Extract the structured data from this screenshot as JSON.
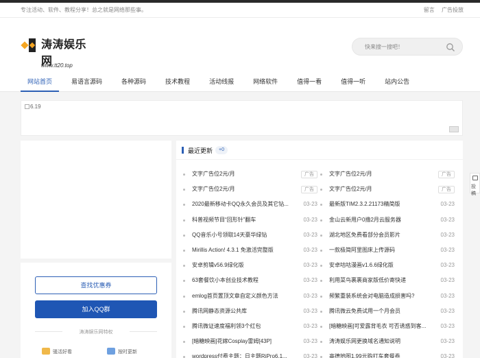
{
  "topbar": {
    "slogan": "专注活动、软件、教程分享！总之就是网络那些事。",
    "links": [
      "留言",
      "广告投放"
    ]
  },
  "logo": {
    "name": "涛涛娱乐网",
    "url": "www.tt20.top"
  },
  "search": {
    "placeholder": "快来搜一搜吧！"
  },
  "nav": {
    "items": [
      "网站首页",
      "易语言源码",
      "各种源码",
      "技术教程",
      "活动线报",
      "网络软件",
      "值得一看",
      "值得一听",
      "站内公告"
    ],
    "active_index": 0
  },
  "banner": {
    "alt": "6.19"
  },
  "left_panel": {
    "coupon_button": "查找优惠券",
    "qq_group_button": "加入QQ群",
    "privilege_title": "涛涛娱乐网特权",
    "features": [
      "骚活好看",
      "按时更新"
    ]
  },
  "latest": {
    "title": "最近更新",
    "count": "+0",
    "col1": [
      {
        "title": "文字广告位2元/月",
        "tag": "广告"
      },
      {
        "title": "文字广告位2元/月",
        "tag": "广告"
      },
      {
        "title": "2020最新移动卡QQ永久会员及其它钻...",
        "date": "03-23"
      },
      {
        "title": "科普视频节目“回形针”翻车",
        "date": "03-23"
      },
      {
        "title": "QQ音乐小号领取14天豪华绿钻",
        "date": "03-23"
      },
      {
        "title": "Mirillis Action! 4.3.1 免激活完整版",
        "date": "03-23"
      },
      {
        "title": "安卓剪辑v56.9绿化版",
        "date": "03-23"
      },
      {
        "title": "63套餐饮小本创业技术教程",
        "date": "03-23"
      },
      {
        "title": "emlog首页置顶文章自定义颜色方法",
        "date": "03-23"
      },
      {
        "title": "腾讯网静态资源公共库",
        "date": "03-23"
      },
      {
        "title": "腾讯微证速度福利领3个红包",
        "date": "03-23"
      },
      {
        "title": "[暗糖映画]花嫁Cosplay雷姆[43P]",
        "date": "03-23"
      },
      {
        "title": "wordpress付费主题：日主题RiPro6.1...",
        "date": "03-23"
      }
    ],
    "col2": [
      {
        "title": "文字广告位2元/月",
        "tag": "广告"
      },
      {
        "title": "文字广告位2元/月",
        "tag": "广告"
      },
      {
        "title": "最新版TIM2.3.2.21173精简版",
        "date": "03-23"
      },
      {
        "title": "金山云新用户0撸2月云服务器",
        "date": "03-23"
      },
      {
        "title": "湖北地区免费看部分会员影片",
        "date": "03-23"
      },
      {
        "title": "一款极简阿里图床上传源码",
        "date": "03-23"
      },
      {
        "title": "安卓咕咕漫画v1.6.6绿化版",
        "date": "03-23"
      },
      {
        "title": "利用菜鸟裹裹商家版低价寄快递",
        "date": "03-23"
      },
      {
        "title": "频繁重装系统会对电脑造成损害吗?",
        "date": "03-23"
      },
      {
        "title": "腾讯微云免费试用一个月会员",
        "date": "03-23"
      },
      {
        "title": "[暗糖映画]可爱露背毛衣 可否诱惑到客...",
        "date": "03-23"
      },
      {
        "title": "涛涛娱乐网更换域名通知说明",
        "date": "03-23"
      },
      {
        "title": "高德地图1.99元购打车套餐卷",
        "date": "03-23"
      }
    ]
  },
  "float_button": "投稿",
  "colors": {
    "accent": "#2c5fb5",
    "primary_button": "#1f56b4",
    "logo_orange": "#f5a623"
  }
}
